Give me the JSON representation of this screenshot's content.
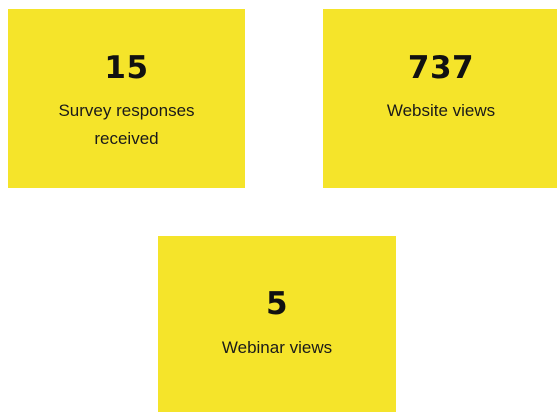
{
  "cards": [
    {
      "value": "15",
      "label_line1": "Survey responses",
      "label_line2": "received"
    },
    {
      "value": "737",
      "label_line1": "Website views"
    },
    {
      "value": "5",
      "label_line1": "Webinar views"
    }
  ],
  "colors": {
    "card_background": "#f5e42a",
    "text": "#111111",
    "page_background": "#ffffff"
  }
}
